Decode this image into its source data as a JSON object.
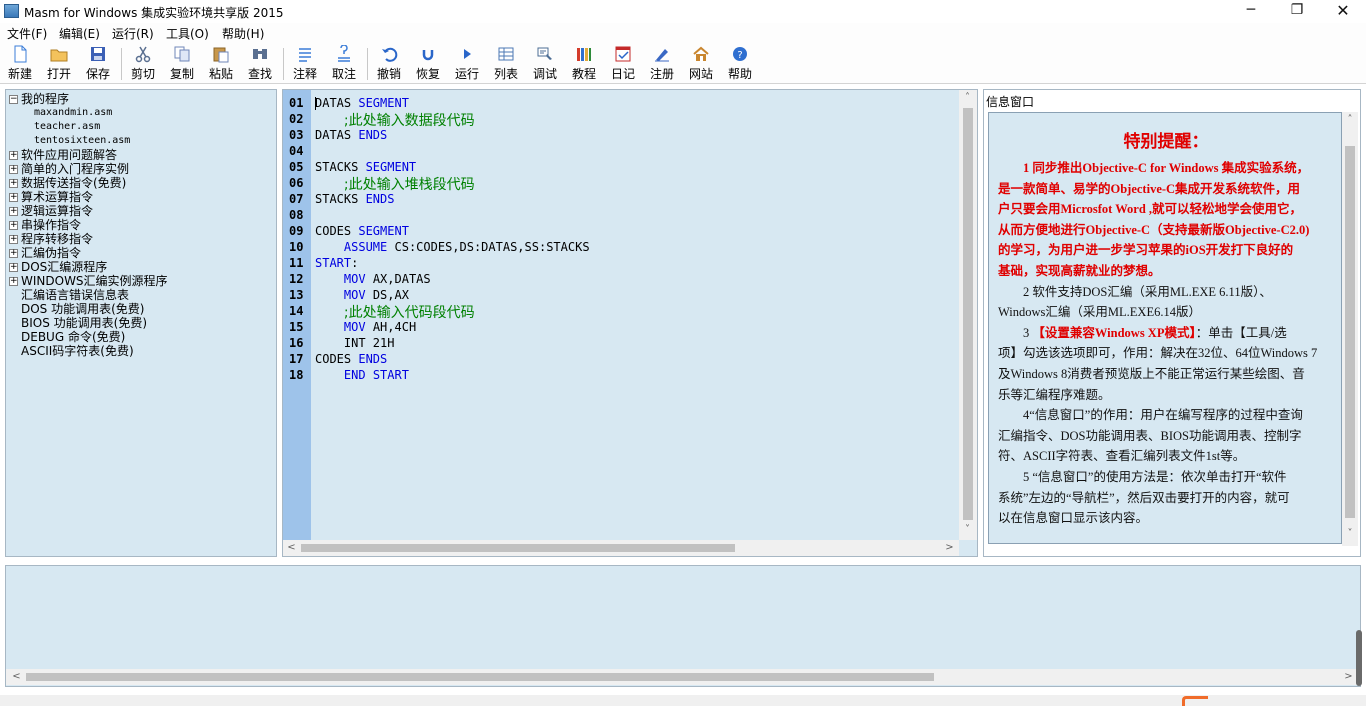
{
  "window": {
    "title": "Masm for Windows 集成实验环境共享版 2015",
    "min_glyph": "─",
    "max_glyph": "❐",
    "close_glyph": "✕"
  },
  "menu": [
    {
      "label": "文件(F)"
    },
    {
      "label": "编辑(E)"
    },
    {
      "label": "运行(R)"
    },
    {
      "label": "工具(O)"
    },
    {
      "label": "帮助(H)"
    }
  ],
  "toolbar": [
    {
      "label": "新建",
      "icon": "new-file-icon",
      "color": "#3b7dd8"
    },
    {
      "label": "打开",
      "icon": "open-folder-icon",
      "color": "#e2a93a"
    },
    {
      "label": "保存",
      "icon": "save-icon",
      "color": "#3b5fb5"
    },
    {
      "label": "剪切",
      "icon": "cut-icon",
      "color": "#5a6f90"
    },
    {
      "label": "复制",
      "icon": "copy-icon",
      "color": "#6f86b8"
    },
    {
      "label": "粘贴",
      "icon": "paste-icon",
      "color": "#c8974a"
    },
    {
      "label": "查找",
      "icon": "find-icon",
      "color": "#5a6f90"
    },
    {
      "label": "注释",
      "icon": "comment-icon",
      "color": "#3b7dd8"
    },
    {
      "label": "取注",
      "icon": "uncomment-icon",
      "color": "#3b7dd8"
    },
    {
      "label": "撤销",
      "icon": "undo-icon",
      "color": "#2a66c9"
    },
    {
      "label": "恢复",
      "icon": "redo-icon",
      "color": "#2a66c9"
    },
    {
      "label": "运行",
      "icon": "run-icon",
      "color": "#2a66c9"
    },
    {
      "label": "列表",
      "icon": "list-icon",
      "color": "#4c78b4"
    },
    {
      "label": "调试",
      "icon": "debug-icon",
      "color": "#4c6d94"
    },
    {
      "label": "教程",
      "icon": "tutorial-icon",
      "color": "#d43c2b"
    },
    {
      "label": "日记",
      "icon": "diary-icon",
      "color": "#c42a2a"
    },
    {
      "label": "注册",
      "icon": "register-icon",
      "color": "#3a68c4"
    },
    {
      "label": "网站",
      "icon": "website-icon",
      "color": "#c9862f"
    },
    {
      "label": "帮助",
      "icon": "help-icon",
      "color": "#2f6fd0"
    }
  ],
  "tree": {
    "root": "我的程序",
    "files": [
      "maxandmin.asm",
      "teacher.asm",
      "tentosixteen.asm"
    ],
    "groups": [
      "软件应用问题解答",
      "简单的入门程序实例",
      "数据传送指令(免费)",
      "算术运算指令",
      "逻辑运算指令",
      "串操作指令",
      "程序转移指令",
      "汇编伪指令",
      "DOS汇编源程序",
      "WINDOWS汇编实例源程序"
    ],
    "leaves": [
      "汇编语言错误信息表",
      "DOS 功能调用表(免费)",
      "BIOS 功能调用表(免费)",
      "DEBUG 命令(免费)",
      "ASCII码字符表(免费)"
    ]
  },
  "editor": {
    "lines": [
      {
        "n": "01",
        "parts": [
          [
            "",
            "DATAS "
          ],
          [
            "kw",
            "SEGMENT"
          ]
        ]
      },
      {
        "n": "02",
        "parts": [
          [
            "",
            "    "
          ],
          [
            "cm",
            ";此处输入数据段代码"
          ]
        ]
      },
      {
        "n": "03",
        "parts": [
          [
            "",
            "DATAS "
          ],
          [
            "kw",
            "ENDS"
          ]
        ]
      },
      {
        "n": "04",
        "parts": []
      },
      {
        "n": "05",
        "parts": [
          [
            "",
            "STACKS "
          ],
          [
            "kw",
            "SEGMENT"
          ]
        ]
      },
      {
        "n": "06",
        "parts": [
          [
            "",
            "    "
          ],
          [
            "cm",
            ";此处输入堆栈段代码"
          ]
        ]
      },
      {
        "n": "07",
        "parts": [
          [
            "",
            "STACKS "
          ],
          [
            "kw",
            "ENDS"
          ]
        ]
      },
      {
        "n": "08",
        "parts": []
      },
      {
        "n": "09",
        "parts": [
          [
            "",
            "CODES "
          ],
          [
            "kw",
            "SEGMENT"
          ]
        ]
      },
      {
        "n": "10",
        "parts": [
          [
            "",
            "    "
          ],
          [
            "kw",
            "ASSUME"
          ],
          [
            "",
            " CS:CODES,DS:DATAS,SS:STACKS"
          ]
        ]
      },
      {
        "n": "11",
        "parts": [
          [
            "kw",
            "START"
          ],
          [
            "",
            ":"
          ]
        ]
      },
      {
        "n": "12",
        "parts": [
          [
            "",
            "    "
          ],
          [
            "kw",
            "MOV"
          ],
          [
            "",
            " AX,DATAS"
          ]
        ]
      },
      {
        "n": "13",
        "parts": [
          [
            "",
            "    "
          ],
          [
            "kw",
            "MOV"
          ],
          [
            "",
            " DS,AX"
          ]
        ]
      },
      {
        "n": "14",
        "parts": [
          [
            "",
            "    "
          ],
          [
            "cm",
            ";此处输入代码段代码"
          ]
        ]
      },
      {
        "n": "15",
        "parts": [
          [
            "",
            "    "
          ],
          [
            "kw",
            "MOV"
          ],
          [
            "",
            " AH,4CH"
          ]
        ]
      },
      {
        "n": "16",
        "parts": [
          [
            "",
            "    INT 21H"
          ]
        ]
      },
      {
        "n": "17",
        "parts": [
          [
            "",
            "CODES "
          ],
          [
            "kw",
            "ENDS"
          ]
        ]
      },
      {
        "n": "18",
        "parts": [
          [
            "",
            "    "
          ],
          [
            "kw",
            "END"
          ],
          [
            "",
            " "
          ],
          [
            "kw",
            "START"
          ]
        ]
      }
    ]
  },
  "info": {
    "title": "信息窗口",
    "heading": "特别提醒：",
    "lines": [
      {
        "red": true,
        "text": "　　1  同步推出Objective-C for Windows 集成实验系统，"
      },
      {
        "red": true,
        "text": "是一款简单、易学的Objective-C集成开发系统软件，用"
      },
      {
        "red": true,
        "text": "户只要会用Microsfot Word ,就可以轻松地学会使用它，"
      },
      {
        "red": true,
        "text": "从而方便地进行Objective-C（支持最新版Objective-C2.0)"
      },
      {
        "red": true,
        "text": "的学习，为用户进一步学习苹果的iOS开发打下良好的"
      },
      {
        "red": true,
        "text": "基础，实现高薪就业的梦想。"
      },
      {
        "red": false,
        "text": "　　2 软件支持DOS汇编（采用ML.EXE 6.11版）、"
      },
      {
        "red": false,
        "text": "Windows汇编（采用ML.EXE6.14版）"
      },
      {
        "red": false,
        "text": "　　3 ",
        "red_part": "【设置兼容Windows XP模式】",
        "after": "：单击【工具/选"
      },
      {
        "red": false,
        "text": "项】勾选该选项即可，作用：解决在32位、64位Windows 7"
      },
      {
        "red": false,
        "text": "及Windows 8消费者预览版上不能正常运行某些绘图、音"
      },
      {
        "red": false,
        "text": "乐等汇编程序难题。"
      },
      {
        "red": false,
        "text": "　　4“信息窗口”的作用：用户在编写程序的过程中查询"
      },
      {
        "red": false,
        "text": "汇编指令、DOS功能调用表、BIOS功能调用表、控制字"
      },
      {
        "red": false,
        "text": "符、ASCII字符表、查看汇编列表文件1st等。"
      },
      {
        "red": false,
        "text": "　　5 “信息窗口”的使用方法是：依次单击打开“软件"
      },
      {
        "red": false,
        "text": "系统”左边的“导航栏”，然后双击要打开的内容，就可"
      },
      {
        "red": false,
        "text": "以在信息窗口显示该内容。"
      }
    ]
  },
  "scroll": {
    "up": "˄",
    "down": "˅",
    "left": "<",
    "right": ">"
  },
  "colors": {
    "panel_bg": "#d7e8f2",
    "gutter_bg": "#9ec3ea",
    "keyword": "#0000e0",
    "comment": "#008000",
    "warning_red": "#e00000"
  }
}
